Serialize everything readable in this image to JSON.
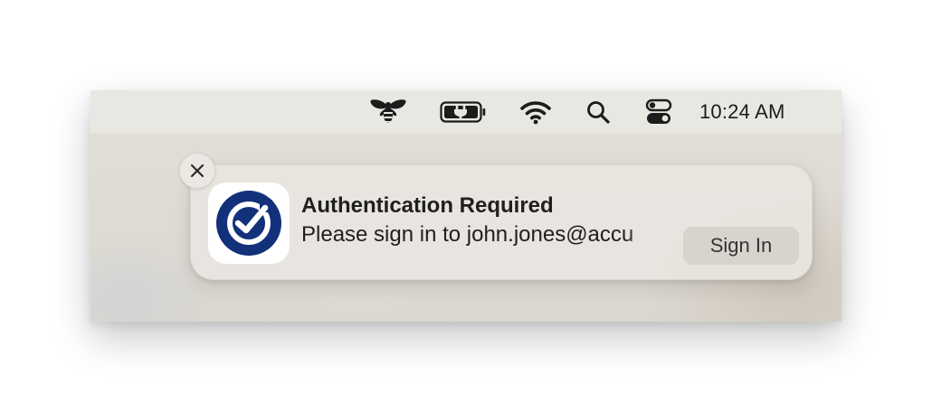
{
  "menubar": {
    "icons": [
      {
        "name": "bee-app-icon"
      },
      {
        "name": "battery-charging-icon"
      },
      {
        "name": "wifi-icon"
      },
      {
        "name": "spotlight-search-icon"
      },
      {
        "name": "control-center-icon"
      }
    ],
    "clock": "10:24 AM"
  },
  "notification": {
    "close_icon": "close-icon",
    "app_icon": "checkmark-app-icon",
    "accent_color": "#13307a",
    "title": "Authentication Required",
    "body": "Please sign in to john.jones@accu",
    "action_label": "Sign In"
  }
}
